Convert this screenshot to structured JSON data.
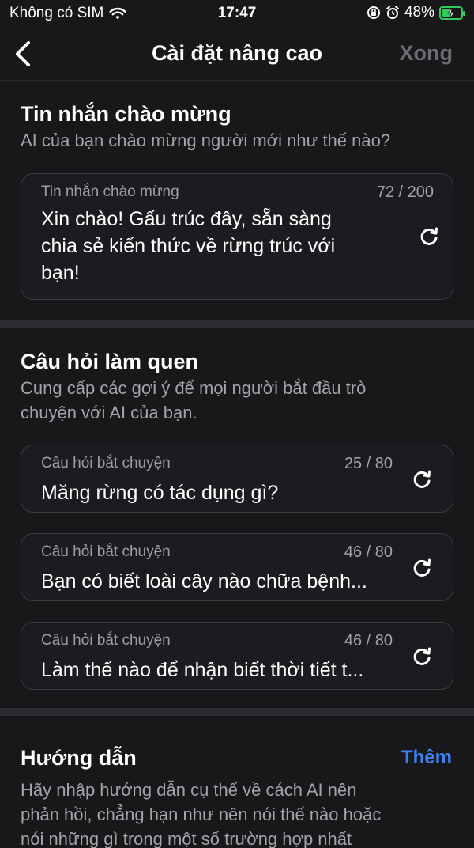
{
  "status": {
    "carrier": "Không có SIM",
    "time": "17:47",
    "battery": "48%",
    "battery_level": 0.48
  },
  "nav": {
    "title": "Cài đặt nâng cao",
    "done_label": "Xong"
  },
  "welcome": {
    "title": "Tin nhắn chào mừng",
    "subtitle": "AI của bạn chào mừng người mới như thế nào?",
    "field_label": "Tin nhắn chào mừng",
    "count": "72 / 200",
    "lines": [
      "Xin chào! Gấu trúc đây, sẵn sàng",
      "chia sẻ kiến thức về rừng trúc với",
      "bạn!"
    ]
  },
  "starters": {
    "title": "Câu hỏi làm quen",
    "subtitle_lines": [
      "Cung cấp các gợi ý để mọi người bắt đầu trò",
      "chuyện với AI của bạn."
    ],
    "items": [
      {
        "label": "Câu hỏi bắt chuyện",
        "count": "25 / 80",
        "value": "Măng rừng có tác dụng gì?"
      },
      {
        "label": "Câu hỏi bắt chuyện",
        "count": "46 / 80",
        "value": "Bạn có biết loài cây nào chữa bệnh..."
      },
      {
        "label": "Câu hỏi bắt chuyện",
        "count": "46 / 80",
        "value": "Làm thế nào để nhận biết thời tiết t..."
      }
    ]
  },
  "guide": {
    "title": "Hướng dẫn",
    "more_label": "Thêm",
    "subtitle_lines": [
      "Hãy nhập hướng dẫn cụ thể về cách AI nên",
      "phản hồi, chẳng hạn như nên nói thế nào hoặc",
      "nói những gì trong một số trường hợp nhất"
    ]
  }
}
